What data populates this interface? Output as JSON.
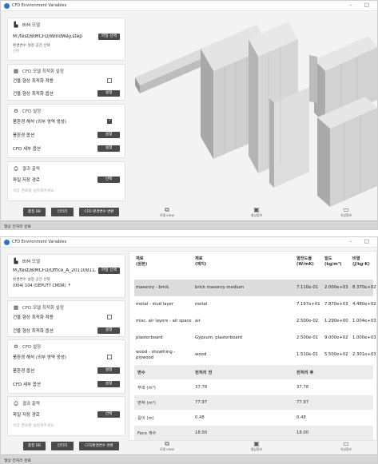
{
  "window": {
    "title": "CFD Environment Variables",
    "minimize_icon": "minimize-icon",
    "close_icon": "close-icon",
    "minimize_glyph": "–",
    "close_glyph": "□"
  },
  "left_panel": {
    "bim": {
      "header": "BIM 모델",
      "icon": "building-icon"
    },
    "optimize": {
      "header": "CFD 모델 최적화 설정",
      "icon": "grid-icon",
      "apply_label": "건물 형상 최적화 적용",
      "options_label": "건물 형상 최적화 옵션",
      "settings_button": "설정"
    },
    "cfd": {
      "header": "CFD 설정",
      "icon": "gear-icon",
      "inflow_label": "풍환경 해석 (외부 영역 생성)",
      "inflow_options_label": "풍환경 옵션",
      "detail_label": "CFD 세부 옵션",
      "settings_button": "설정"
    },
    "output": {
      "header": "결과 출력",
      "icon": "printer-icon",
      "path_label": "파일 저장 경로",
      "select_button": "선택",
      "path_placeholder": "저장 경로를 설정해주세요"
    }
  },
  "screen1": {
    "bim_path": "M:/test/BIMCFD/WindWay.step",
    "file_select_button": "파일 선택",
    "space_label": "환경변수 설정 공간 선택",
    "space_value": "선택",
    "apply_checked": false,
    "inflow_checked": true,
    "buttons": [
      "품질 DB",
      "인터리",
      "CFD 환경변수 변환"
    ],
    "status": "형상 전처리 완료",
    "toolbar": [
      {
        "icon": "cube-icon",
        "glyph": "⧉",
        "label": "모델 VIEW"
      },
      {
        "icon": "image-icon",
        "glyph": "▣",
        "label": "형상정보"
      },
      {
        "icon": "monitor-icon",
        "glyph": "▭",
        "label": "속성정보"
      }
    ]
  },
  "screen2": {
    "bim_path": "M:/test/BIMCFD/Office_A_20110811.ifc",
    "file_select_button": "파일 선택",
    "space_label": "환경변수 설정 공간 선택",
    "space_value": "(004) 104 (DEPUTY CMDR)",
    "apply_checked": false,
    "inflow_checked": false,
    "buttons": [
      "품질 DB",
      "인터리",
      "CFD환경변수 변환"
    ],
    "status": "형상 전처리 완료",
    "toolbar": [
      {
        "icon": "cube-icon",
        "glyph": "⧉",
        "label": "모델 VIEW"
      },
      {
        "icon": "image-icon",
        "glyph": "▣",
        "label": "형상정보"
      },
      {
        "icon": "monitor-icon",
        "glyph": "▭",
        "label": "속성정보"
      }
    ],
    "materials": {
      "headers": [
        [
          "재료",
          "(원본)"
        ],
        [
          "재료",
          "(매치)"
        ],
        [
          "열전도율",
          "(W/mK)"
        ],
        [
          "밀도",
          "(kg/m³)"
        ],
        [
          "비열",
          "(J/kg·K)"
        ]
      ],
      "rows": [
        {
          "original": "masonry - brick",
          "matched": "brick masonry medium",
          "k": "7.110e-01",
          "rho": "2.000e+03",
          "cp": "8.370e+02",
          "selected": true
        },
        {
          "original": "metal - stud layer",
          "matched": "metal",
          "k": "7.197e+01",
          "rho": "7.870e+03",
          "cp": "4.480e+02",
          "selected": false
        },
        {
          "original": "misc. air layers - air space",
          "matched": "air",
          "k": "2.500e-02",
          "rho": "1.290e+00",
          "cp": "1.004e+03",
          "selected": false
        },
        {
          "original": "plasterboard",
          "matched": "Gypsum, plasterboard",
          "k": "2.500e-01",
          "rho": "9.000e+02",
          "cp": "1.000e+03",
          "selected": false
        },
        {
          "original": "wood - sheathing - plywood",
          "matched": "wood",
          "k": "1.510e-01",
          "rho": "5.500e+02",
          "cp": "2.301e+03",
          "selected": false
        }
      ]
    },
    "properties": {
      "headers": [
        "변수",
        "전처리 전",
        "전처리 후"
      ],
      "rows": [
        [
          "부피 (m³)",
          "37.78",
          "37.78"
        ],
        [
          "면적 (m²)",
          "77.97",
          "77.97"
        ],
        [
          "길이 (m)",
          "0.48",
          "0.48"
        ],
        [
          "Face 개수",
          "18.00",
          "18.00"
        ]
      ]
    }
  }
}
